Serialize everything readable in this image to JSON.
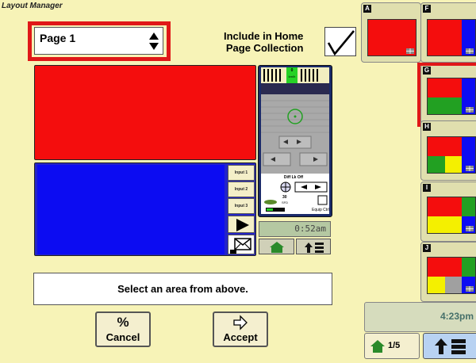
{
  "window": {
    "title": "Layout Manager"
  },
  "page_selector": {
    "value": "Page 1"
  },
  "include": {
    "label_line1": "Include in Home",
    "label_line2": "Page Collection",
    "checked": true
  },
  "preview": {
    "input_buttons": [
      "Input 1",
      "Input 2",
      "Input 3"
    ],
    "monitor": {
      "strip_value": "0",
      "strip_unit": "km/h",
      "diff_lock_label": "Diff Lk Off",
      "counter_value": "30",
      "counter_unit": "SFD",
      "equip_label": "Equip Ctrl",
      "clock": "0:52am"
    }
  },
  "message": "Select an area from above.",
  "actions": {
    "cancel": "Cancel",
    "accept": "Accept"
  },
  "layouts": [
    "A",
    "F",
    "G",
    "H",
    "I",
    "J"
  ],
  "selected_layout": "G",
  "status": {
    "time": "4:23pm",
    "page": "1/5"
  },
  "colors": {
    "background": "#f7f3b7",
    "red": "#f40d0d",
    "blue": "#0c0cf2",
    "green": "#22a022",
    "yellow": "#f4f000",
    "gray": "#a0a0a0",
    "selection": "#e01818"
  }
}
